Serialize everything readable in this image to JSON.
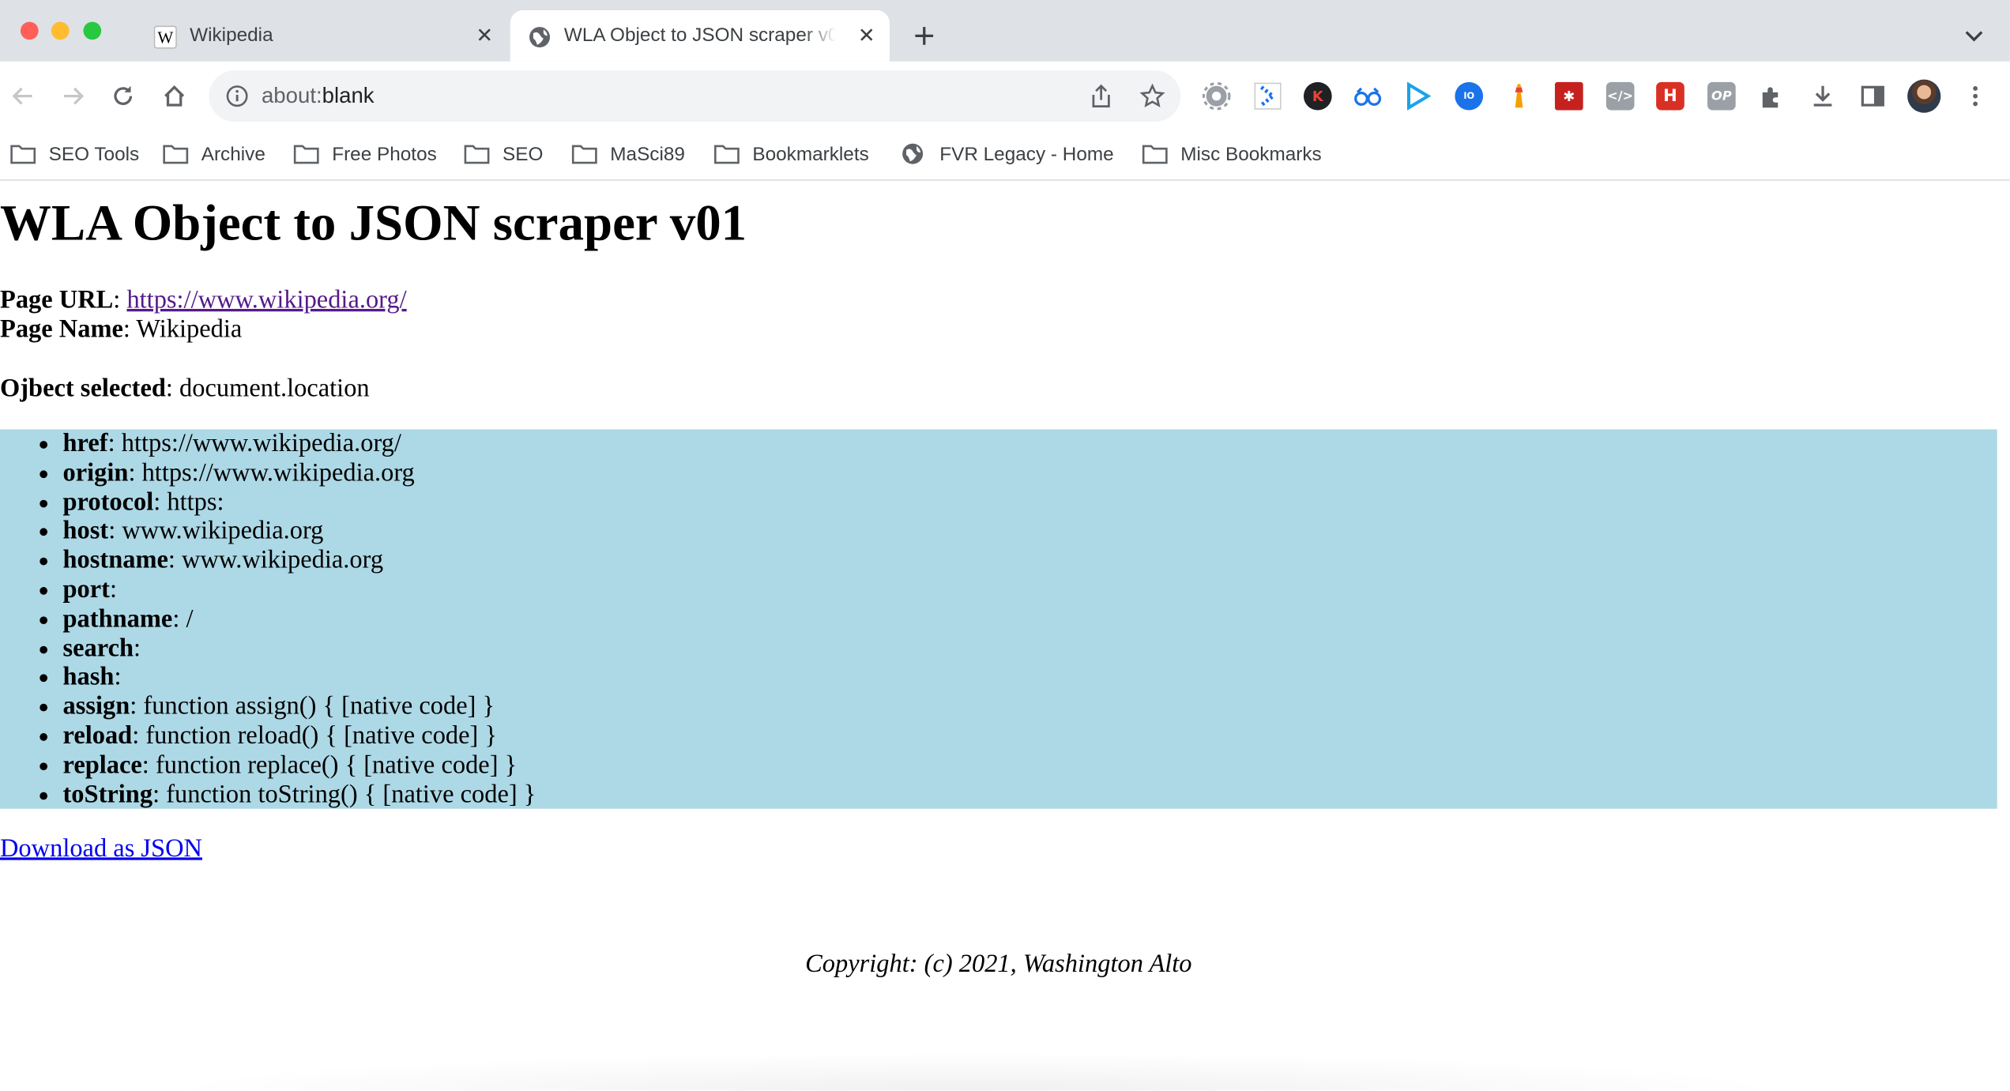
{
  "browser": {
    "tabs": [
      {
        "title": "Wikipedia",
        "favicon": "wikipedia-w-icon",
        "active": false
      },
      {
        "title": "WLA Object to JSON scraper v01",
        "favicon": "globe-icon",
        "active": true
      }
    ],
    "address": {
      "scheme": "about:",
      "rest": "blank"
    },
    "bookmarks": [
      {
        "label": "SEO Tools",
        "icon": "folder-icon"
      },
      {
        "label": "Archive",
        "icon": "folder-icon"
      },
      {
        "label": "Free Photos",
        "icon": "folder-icon"
      },
      {
        "label": "SEO",
        "icon": "folder-icon"
      },
      {
        "label": "MaSci89",
        "icon": "folder-icon"
      },
      {
        "label": "Bookmarklets",
        "icon": "folder-icon"
      },
      {
        "label": "FVR Legacy - Home",
        "icon": "globe-icon"
      },
      {
        "label": "Misc Bookmarks",
        "icon": "folder-icon"
      }
    ]
  },
  "page": {
    "title": "WLA Object to JSON scraper v01",
    "url_label": "Page URL",
    "url": "https://www.wikipedia.org/",
    "name_label": "Page Name",
    "name": "Wikipedia",
    "object_label": "Ojbect selected",
    "object": "document.location",
    "properties": [
      {
        "key": "href",
        "value": "https://www.wikipedia.org/"
      },
      {
        "key": "origin",
        "value": "https://www.wikipedia.org"
      },
      {
        "key": "protocol",
        "value": "https:"
      },
      {
        "key": "host",
        "value": "www.wikipedia.org"
      },
      {
        "key": "hostname",
        "value": "www.wikipedia.org"
      },
      {
        "key": "port",
        "value": ""
      },
      {
        "key": "pathname",
        "value": "/"
      },
      {
        "key": "search",
        "value": ""
      },
      {
        "key": "hash",
        "value": ""
      },
      {
        "key": "assign",
        "value": "function assign() { [native code] }"
      },
      {
        "key": "reload",
        "value": "function reload() { [native code] }"
      },
      {
        "key": "replace",
        "value": "function replace() { [native code] }"
      },
      {
        "key": "toString",
        "value": "function toString() { [native code] }"
      }
    ],
    "download_label": "Download as JSON",
    "copyright": "Copyright: (c) 2021, Washington Alto",
    "highlight_color": "#add8e6"
  }
}
